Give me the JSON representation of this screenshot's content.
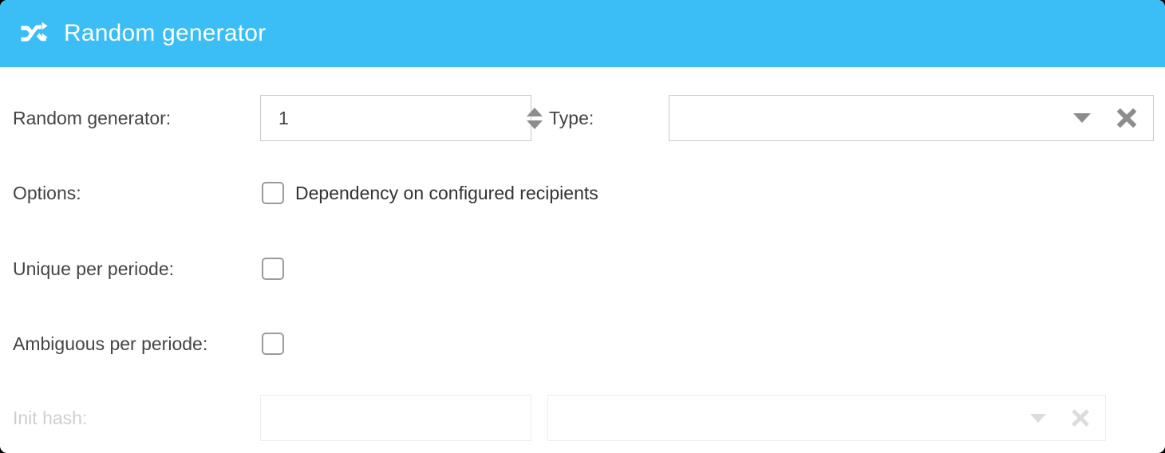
{
  "header": {
    "icon": "shuffle-icon",
    "title": "Random generator",
    "background_color": "#3bbdf5",
    "text_color": "#ffffff"
  },
  "form": {
    "generator": {
      "label": "Random generator:",
      "value": "1",
      "spinner_up_icon": "triangle-up-icon",
      "spinner_down_icon": "triangle-down-icon"
    },
    "type": {
      "label": "Type:",
      "value": "",
      "placeholder": "",
      "caret_icon": "chevron-down-icon",
      "clear_icon": "close-icon"
    },
    "options": {
      "label": "Options:",
      "checkbox_label": "Dependency on configured recipients",
      "checked": false
    },
    "unique_per_periode": {
      "label": "Unique per periode:",
      "checked": false
    },
    "ambiguous_per_periode": {
      "label": "Ambiguous per periode:",
      "checked": false
    },
    "init_hash": {
      "label": "Init hash:",
      "value": "",
      "placeholder": "",
      "select_value": "",
      "caret_icon": "chevron-down-icon",
      "clear_icon": "close-icon",
      "disabled": true
    }
  }
}
